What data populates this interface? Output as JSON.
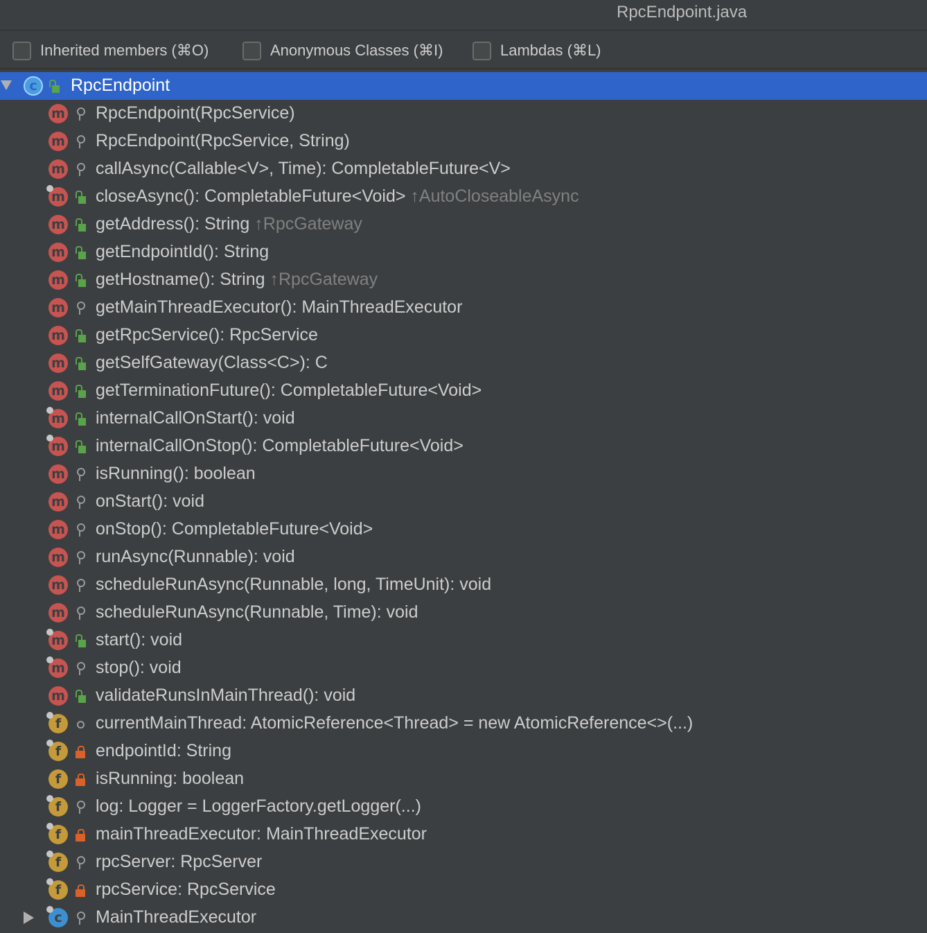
{
  "window": {
    "title": "RpcEndpoint.java"
  },
  "toolbar": {
    "checkboxes": [
      {
        "label": "Inherited members (⌘O)",
        "checked": false
      },
      {
        "label": "Anonymous Classes (⌘I)",
        "checked": false
      },
      {
        "label": "Lambdas (⌘L)",
        "checked": false
      }
    ]
  },
  "tree": {
    "root": {
      "name": "RpcEndpoint",
      "kind": "c",
      "expanded": true,
      "selected": true
    },
    "members": [
      {
        "kind": "m",
        "vis": "key",
        "overlay": false,
        "text": "RpcEndpoint(RpcService)",
        "inherited": ""
      },
      {
        "kind": "m",
        "vis": "key",
        "overlay": false,
        "text": "RpcEndpoint(RpcService, String)",
        "inherited": ""
      },
      {
        "kind": "m",
        "vis": "key",
        "overlay": false,
        "text": "callAsync(Callable<V>, Time): CompletableFuture<V>",
        "inherited": ""
      },
      {
        "kind": "m",
        "vis": "pub",
        "overlay": true,
        "text": "closeAsync(): CompletableFuture<Void>",
        "inherited": "↑AutoCloseableAsync"
      },
      {
        "kind": "m",
        "vis": "pub",
        "overlay": false,
        "text": "getAddress(): String",
        "inherited": "↑RpcGateway"
      },
      {
        "kind": "m",
        "vis": "pub",
        "overlay": false,
        "text": "getEndpointId(): String",
        "inherited": ""
      },
      {
        "kind": "m",
        "vis": "pub",
        "overlay": false,
        "text": "getHostname(): String",
        "inherited": "↑RpcGateway"
      },
      {
        "kind": "m",
        "vis": "key",
        "overlay": false,
        "text": "getMainThreadExecutor(): MainThreadExecutor",
        "inherited": ""
      },
      {
        "kind": "m",
        "vis": "pub",
        "overlay": false,
        "text": "getRpcService(): RpcService",
        "inherited": ""
      },
      {
        "kind": "m",
        "vis": "pub",
        "overlay": false,
        "text": "getSelfGateway(Class<C>): C",
        "inherited": ""
      },
      {
        "kind": "m",
        "vis": "pub",
        "overlay": false,
        "text": "getTerminationFuture(): CompletableFuture<Void>",
        "inherited": ""
      },
      {
        "kind": "m",
        "vis": "pub",
        "overlay": true,
        "text": "internalCallOnStart(): void",
        "inherited": ""
      },
      {
        "kind": "m",
        "vis": "pub",
        "overlay": true,
        "text": "internalCallOnStop(): CompletableFuture<Void>",
        "inherited": ""
      },
      {
        "kind": "m",
        "vis": "key",
        "overlay": false,
        "text": "isRunning(): boolean",
        "inherited": ""
      },
      {
        "kind": "m",
        "vis": "key",
        "overlay": false,
        "text": "onStart(): void",
        "inherited": ""
      },
      {
        "kind": "m",
        "vis": "key",
        "overlay": false,
        "text": "onStop(): CompletableFuture<Void>",
        "inherited": ""
      },
      {
        "kind": "m",
        "vis": "key",
        "overlay": false,
        "text": "runAsync(Runnable): void",
        "inherited": ""
      },
      {
        "kind": "m",
        "vis": "key",
        "overlay": false,
        "text": "scheduleRunAsync(Runnable, long, TimeUnit): void",
        "inherited": ""
      },
      {
        "kind": "m",
        "vis": "key",
        "overlay": false,
        "text": "scheduleRunAsync(Runnable, Time): void",
        "inherited": ""
      },
      {
        "kind": "m",
        "vis": "pub",
        "overlay": true,
        "text": "start(): void",
        "inherited": ""
      },
      {
        "kind": "m",
        "vis": "key",
        "overlay": true,
        "text": "stop(): void",
        "inherited": ""
      },
      {
        "kind": "m",
        "vis": "pub",
        "overlay": false,
        "text": "validateRunsInMainThread(): void",
        "inherited": ""
      },
      {
        "kind": "f",
        "vis": "pkg",
        "overlay": true,
        "text": "currentMainThread: AtomicReference<Thread> = new AtomicReference<>(...)",
        "inherited": ""
      },
      {
        "kind": "f",
        "vis": "priv",
        "overlay": true,
        "text": "endpointId: String",
        "inherited": ""
      },
      {
        "kind": "f",
        "vis": "priv",
        "overlay": false,
        "text": "isRunning: boolean",
        "inherited": ""
      },
      {
        "kind": "f",
        "vis": "key",
        "overlay": true,
        "text": "log: Logger = LoggerFactory.getLogger(...)",
        "inherited": ""
      },
      {
        "kind": "f",
        "vis": "priv",
        "overlay": true,
        "text": "mainThreadExecutor: MainThreadExecutor",
        "inherited": ""
      },
      {
        "kind": "f",
        "vis": "key",
        "overlay": true,
        "text": "rpcServer: RpcServer",
        "inherited": ""
      },
      {
        "kind": "f",
        "vis": "priv",
        "overlay": true,
        "text": "rpcService: RpcService",
        "inherited": ""
      }
    ],
    "inner": {
      "kind": "c",
      "vis": "key",
      "overlay": true,
      "text": "MainThreadExecutor",
      "expanded": false
    }
  }
}
